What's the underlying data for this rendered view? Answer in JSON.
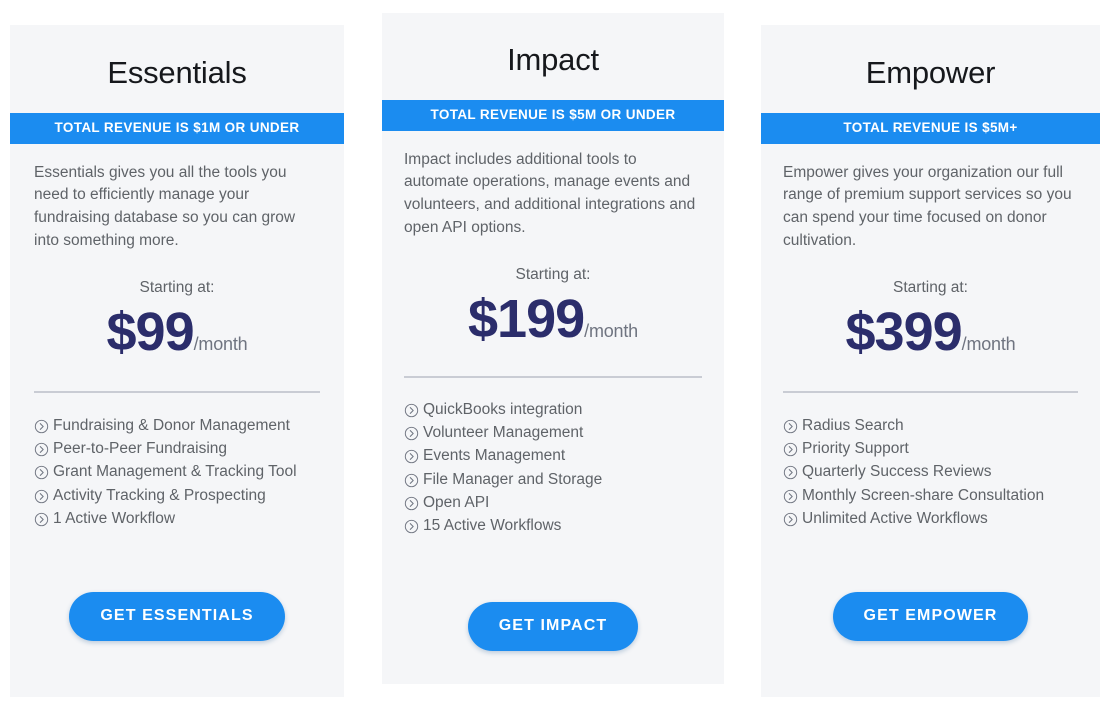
{
  "plans": [
    {
      "name": "Essentials",
      "revenue_banner": "TOTAL REVENUE IS $1M OR UNDER",
      "description": "Essentials gives you all the tools you need to efficiently manage your   fundraising database so you can grow into something more.",
      "starting_label": "Starting at:",
      "price": "$99",
      "period": "/month",
      "features": [
        "Fundraising & Donor Management",
        "Peer-to-Peer Fundraising",
        "Grant Management & Tracking Tool",
        "Activity Tracking & Prospecting",
        "1 Active Workflow"
      ],
      "cta_label": "GET ESSENTIALS"
    },
    {
      "name": "Impact",
      "revenue_banner": "TOTAL REVENUE IS $5M OR UNDER",
      "description": "Impact includes additional tools to automate operations, manage events and volunteers, and additional integrations and open API options.",
      "starting_label": "Starting at:",
      "price": "$199",
      "period": "/month",
      "features": [
        "QuickBooks integration",
        "Volunteer Management",
        "Events Management",
        "File Manager and Storage",
        "Open API",
        "15 Active Workflows"
      ],
      "cta_label": "GET IMPACT"
    },
    {
      "name": "Empower",
      "revenue_banner": "TOTAL REVENUE IS $5M+",
      "description": "Empower gives your organization our full range of premium support services so you can spend your time focused on donor cultivation.",
      "starting_label": "Starting at:",
      "price": "$399",
      "period": "/month",
      "features": [
        "Radius Search",
        "Priority Support",
        "Quarterly Success Reviews",
        "Monthly Screen-share Consultation",
        "Unlimited Active Workflows"
      ],
      "cta_label": "GET EMPOWER"
    }
  ],
  "icons": {
    "feature_bullet": "circle-chevron-right-icon"
  },
  "colors": {
    "accent_blue": "#1b8cf0",
    "price_navy": "#2b2d6b",
    "card_background": "#f5f6f8",
    "body_text": "#5f6368",
    "title_text": "#16181c",
    "divider": "#c9ccd4",
    "page_background": "#ffffff"
  }
}
